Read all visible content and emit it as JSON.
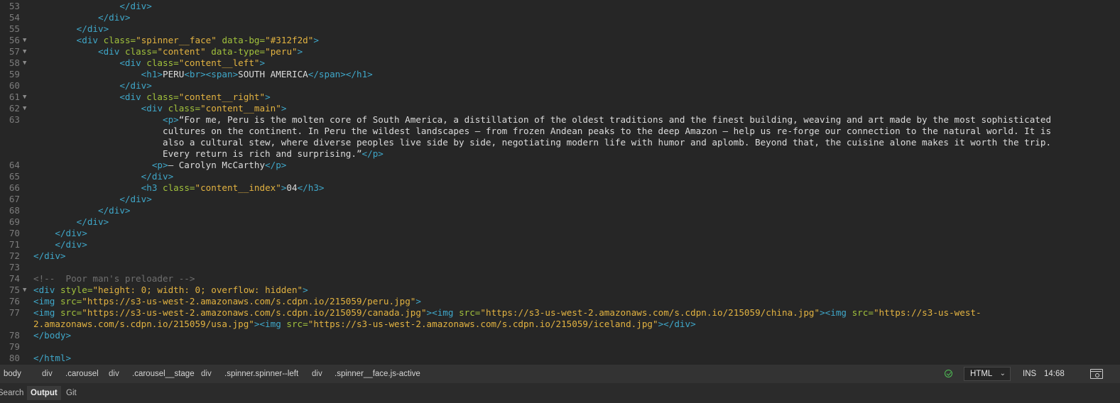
{
  "editor": {
    "lines": [
      {
        "n": "53",
        "fold": false,
        "html": "                <span class=\"t\">&lt;/div&gt;</span>"
      },
      {
        "n": "54",
        "fold": false,
        "html": "            <span class=\"t\">&lt;/div&gt;</span>"
      },
      {
        "n": "55",
        "fold": false,
        "html": "        <span class=\"t\">&lt;/div&gt;</span>"
      },
      {
        "n": "56",
        "fold": true,
        "html": "        <span class=\"t\">&lt;div</span> <span class=\"a\">class=</span><span class=\"s\">\"spinner__face\"</span> <span class=\"a\">data-bg=</span><span class=\"s\">\"#312f2d\"</span><span class=\"t\">&gt;</span>"
      },
      {
        "n": "57",
        "fold": true,
        "html": "            <span class=\"t\">&lt;div</span> <span class=\"a\">class=</span><span class=\"s\">\"content\"</span> <span class=\"a\">data-type=</span><span class=\"s\">\"peru\"</span><span class=\"t\">&gt;</span>"
      },
      {
        "n": "58",
        "fold": true,
        "html": "                <span class=\"t\">&lt;div</span> <span class=\"a\">class=</span><span class=\"s\">\"content__left\"</span><span class=\"t\">&gt;</span>"
      },
      {
        "n": "59",
        "fold": false,
        "html": "                    <span class=\"t\">&lt;h1&gt;</span><span class=\"x\">PERU</span><span class=\"t\">&lt;br&gt;&lt;span&gt;</span><span class=\"x\">SOUTH AMERICA</span><span class=\"t\">&lt;/span&gt;&lt;/h1&gt;</span>"
      },
      {
        "n": "60",
        "fold": false,
        "html": "                <span class=\"t\">&lt;/div&gt;</span>"
      },
      {
        "n": "61",
        "fold": true,
        "html": "                <span class=\"t\">&lt;div</span> <span class=\"a\">class=</span><span class=\"s\">\"content__right\"</span><span class=\"t\">&gt;</span>"
      },
      {
        "n": "62",
        "fold": true,
        "html": "                    <span class=\"t\">&lt;div</span> <span class=\"a\">class=</span><span class=\"s\">\"content__main\"</span><span class=\"t\">&gt;</span>"
      },
      {
        "n": "63",
        "fold": false,
        "html": "                        <span class=\"t\">&lt;p&gt;</span><span class=\"x\">“For me, Peru is the molten core of South America, a distillation of the oldest traditions and the finest building, weaving and art made by the most sophisticated</span>"
      },
      {
        "n": "",
        "fold": false,
        "html": "                        <span class=\"x\">cultures on the continent. In Peru the wildest landscapes – from frozen Andean peaks to the deep Amazon – help us re-forge our connection to the natural world. It is</span>"
      },
      {
        "n": "",
        "fold": false,
        "html": "                        <span class=\"x\">also a cultural stew, where diverse peoples live side by side, negotiating modern life with humor and aplomb. Beyond that, the cuisine alone makes it worth the trip.</span>"
      },
      {
        "n": "",
        "fold": false,
        "html": "                        <span class=\"x\">Every return is rich and surprising.”</span><span class=\"t\">&lt;/p&gt;</span>"
      },
      {
        "n": "64",
        "fold": false,
        "html": "                      <span class=\"t\">&lt;p&gt;</span><span class=\"x\">– Carolyn McCarthy</span><span class=\"t\">&lt;/p&gt;</span>"
      },
      {
        "n": "65",
        "fold": false,
        "html": "                    <span class=\"t\">&lt;/div&gt;</span>"
      },
      {
        "n": "66",
        "fold": false,
        "html": "                    <span class=\"t\">&lt;h3</span> <span class=\"a\">class=</span><span class=\"s\">\"content__index\"</span><span class=\"t\">&gt;</span><span class=\"x\">04</span><span class=\"t\">&lt;/h3&gt;</span>"
      },
      {
        "n": "67",
        "fold": false,
        "html": "                <span class=\"t\">&lt;/div&gt;</span>"
      },
      {
        "n": "68",
        "fold": false,
        "html": "            <span class=\"t\">&lt;/div&gt;</span>"
      },
      {
        "n": "69",
        "fold": false,
        "html": "        <span class=\"t\">&lt;/div&gt;</span>"
      },
      {
        "n": "70",
        "fold": false,
        "html": "    <span class=\"t\">&lt;/div&gt;</span>"
      },
      {
        "n": "71",
        "fold": false,
        "html": "    <span class=\"t\">&lt;/div&gt;</span>"
      },
      {
        "n": "72",
        "fold": false,
        "html": "<span class=\"t\">&lt;/div&gt;</span>"
      },
      {
        "n": "73",
        "fold": false,
        "html": ""
      },
      {
        "n": "74",
        "fold": false,
        "html": "<span class=\"c\">&lt;!--  Poor man's preloader --&gt;</span>"
      },
      {
        "n": "75",
        "fold": true,
        "html": "<span class=\"t\">&lt;div</span> <span class=\"a\">style=</span><span class=\"s\">\"height: 0; width: 0; overflow: hidden\"</span><span class=\"t\">&gt;</span>"
      },
      {
        "n": "76",
        "fold": false,
        "html": "<span class=\"t\">&lt;img</span> <span class=\"a\">src=</span><span class=\"s\">\"https://s3-us-west-2.amazonaws.com/s.cdpn.io/215059/peru.jpg\"</span><span class=\"t\">&gt;</span>"
      },
      {
        "n": "77",
        "fold": false,
        "html": "<span class=\"t\">&lt;img</span> <span class=\"a\">src=</span><span class=\"s\">\"https://s3-us-west-2.amazonaws.com/s.cdpn.io/215059/canada.jpg\"</span><span class=\"t\">&gt;&lt;img</span> <span class=\"a\">src=</span><span class=\"s\">\"https://s3-us-west-2.amazonaws.com/s.cdpn.io/215059/china.jpg\"</span><span class=\"t\">&gt;&lt;img</span> <span class=\"a\">src=</span><span class=\"s\">\"https://s3-us-west-</span>"
      },
      {
        "n": "",
        "fold": false,
        "html": "<span class=\"s\">2.amazonaws.com/s.cdpn.io/215059/usa.jpg\"</span><span class=\"t\">&gt;&lt;img</span> <span class=\"a\">src=</span><span class=\"s\">\"https://s3-us-west-2.amazonaws.com/s.cdpn.io/215059/iceland.jpg\"</span><span class=\"t\">&gt;&lt;/div&gt;</span>"
      },
      {
        "n": "78",
        "fold": false,
        "html": "<span class=\"t\">&lt;/body&gt;</span>"
      },
      {
        "n": "79",
        "fold": false,
        "html": ""
      },
      {
        "n": "80",
        "fold": false,
        "html": "<span class=\"t\">&lt;/html&gt;</span>"
      }
    ]
  },
  "statusbar": {
    "breadcrumbs": [
      "body",
      "div",
      ".carousel",
      "div",
      ".carousel__stage",
      "div",
      ".spinner.spinner--left",
      "div",
      ".spinner__face.js-active"
    ],
    "language": "HTML",
    "mode": "INS",
    "cursor": "14:68"
  },
  "panels": {
    "tabs": [
      "Search",
      "Output",
      "Git"
    ],
    "active": "Output"
  },
  "colors": {
    "tag": "#3fa7c9",
    "attr": "#a1c13c",
    "string": "#e3b341",
    "comment": "#6f6f6f",
    "ok": "#4fbf55"
  }
}
